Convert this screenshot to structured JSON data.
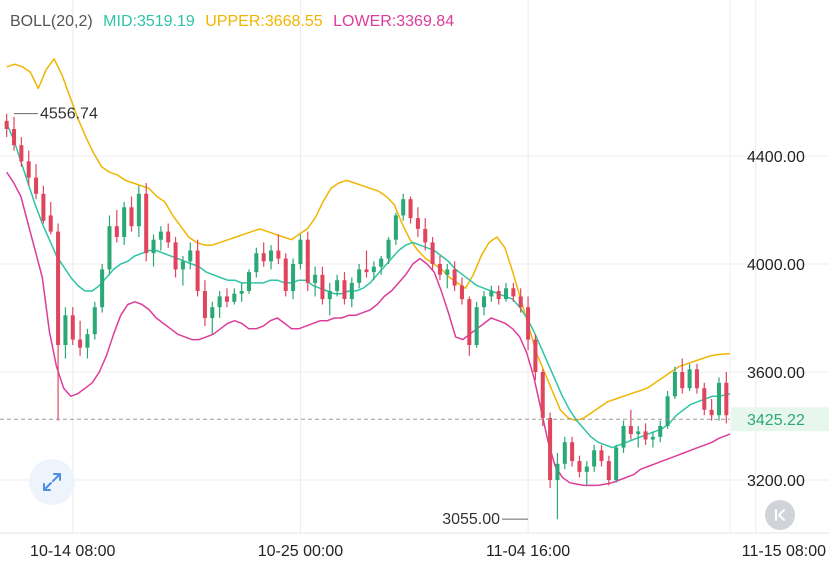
{
  "indicator": {
    "name": "BOLL(20,2)",
    "mid_label": "MID:",
    "mid_value": "3519.19",
    "upper_label": "UPPER:",
    "upper_value": "3668.55",
    "lower_label": "LOWER:",
    "lower_value": "3369.84"
  },
  "colors": {
    "up": "#2aa876",
    "down": "#e0455e",
    "mid": "#2ec4a6",
    "upper": "#f0b500",
    "lower": "#dc3d9b",
    "grid": "#ececec",
    "text": "#222222",
    "current_bg": "#e8f7ee",
    "current_text": "#2aa876"
  },
  "icons": {
    "expand": "expand-arrows-icon",
    "back": "double-chevron-left-icon"
  },
  "chart_data": {
    "type": "candlestick",
    "price_range": [
      3000,
      4700
    ],
    "y_ticks": [
      {
        "value": 4400,
        "label": "4400.00"
      },
      {
        "value": 4000,
        "label": "4000.00"
      },
      {
        "value": 3600,
        "label": "3600.00"
      },
      {
        "value": 3200,
        "label": "3200.00"
      }
    ],
    "x_labels": [
      {
        "index": 9,
        "label": "10-14 08:00"
      },
      {
        "index": 40,
        "label": "10-25 00:00"
      },
      {
        "index": 71,
        "label": "11-04 16:00"
      },
      {
        "index": 102,
        "label": "11-15 08:00"
      }
    ],
    "max_marker": {
      "index": 1,
      "value": 4556.74,
      "label": "4556.74"
    },
    "min_marker": {
      "index": 71,
      "value": 3055.0,
      "label": "3055.00"
    },
    "current_price": {
      "value": 3425.22,
      "label": "3425.22"
    },
    "candles": [
      [
        4530,
        4556,
        4470,
        4500
      ],
      [
        4500,
        4545,
        4420,
        4440
      ],
      [
        4440,
        4470,
        4360,
        4380
      ],
      [
        4380,
        4420,
        4290,
        4320
      ],
      [
        4320,
        4370,
        4240,
        4260
      ],
      [
        4260,
        4290,
        4150,
        4160
      ],
      [
        4180,
        4230,
        4110,
        4120
      ],
      [
        4120,
        4150,
        3420,
        3700
      ],
      [
        3700,
        3840,
        3650,
        3810
      ],
      [
        3810,
        3840,
        3700,
        3720
      ],
      [
        3720,
        3790,
        3660,
        3690
      ],
      [
        3690,
        3760,
        3650,
        3740
      ],
      [
        3740,
        3860,
        3720,
        3840
      ],
      [
        3840,
        4000,
        3820,
        3980
      ],
      [
        3980,
        4180,
        3960,
        4140
      ],
      [
        4140,
        4200,
        4080,
        4100
      ],
      [
        4100,
        4230,
        4070,
        4210
      ],
      [
        4210,
        4250,
        4120,
        4140
      ],
      [
        4140,
        4290,
        4100,
        4260
      ],
      [
        4260,
        4300,
        4010,
        4040
      ],
      [
        4040,
        4110,
        3990,
        4090
      ],
      [
        4090,
        4140,
        4050,
        4120
      ],
      [
        4120,
        4150,
        4060,
        4080
      ],
      [
        4080,
        4100,
        3950,
        3980
      ],
      [
        3980,
        4030,
        3920,
        4010
      ],
      [
        4010,
        4080,
        3980,
        4050
      ],
      [
        4050,
        4090,
        3880,
        3900
      ],
      [
        3900,
        3940,
        3770,
        3800
      ],
      [
        3800,
        3860,
        3740,
        3840
      ],
      [
        3840,
        3900,
        3800,
        3880
      ],
      [
        3880,
        3910,
        3840,
        3860
      ],
      [
        3860,
        3910,
        3850,
        3890
      ],
      [
        3890,
        3930,
        3860,
        3900
      ],
      [
        3900,
        3980,
        3890,
        3970
      ],
      [
        3970,
        4060,
        3950,
        4040
      ],
      [
        4040,
        4080,
        3990,
        4010
      ],
      [
        4010,
        4070,
        3980,
        4050
      ],
      [
        4050,
        4110,
        4000,
        4020
      ],
      [
        4020,
        4040,
        3880,
        3900
      ],
      [
        3900,
        4020,
        3870,
        4000
      ],
      [
        4000,
        4110,
        3980,
        4090
      ],
      [
        4090,
        4120,
        3900,
        3930
      ],
      [
        3930,
        3990,
        3880,
        3960
      ],
      [
        3960,
        3990,
        3850,
        3870
      ],
      [
        3870,
        3930,
        3810,
        3900
      ],
      [
        3900,
        3960,
        3880,
        3940
      ],
      [
        3940,
        3970,
        3850,
        3870
      ],
      [
        3870,
        3950,
        3840,
        3930
      ],
      [
        3930,
        4000,
        3910,
        3980
      ],
      [
        3980,
        4050,
        3950,
        3970
      ],
      [
        3970,
        4010,
        3940,
        3990
      ],
      [
        3990,
        4030,
        3960,
        4020
      ],
      [
        4020,
        4100,
        4000,
        4090
      ],
      [
        4090,
        4190,
        4070,
        4180
      ],
      [
        4180,
        4260,
        4160,
        4240
      ],
      [
        4240,
        4250,
        4150,
        4170
      ],
      [
        4170,
        4210,
        4100,
        4130
      ],
      [
        4130,
        4170,
        4050,
        4080
      ],
      [
        4080,
        4100,
        3980,
        4000
      ],
      [
        4000,
        4030,
        3940,
        3960
      ],
      [
        3960,
        4000,
        3910,
        3980
      ],
      [
        3980,
        4010,
        3900,
        3920
      ],
      [
        3920,
        3950,
        3850,
        3870
      ],
      [
        3870,
        3880,
        3660,
        3700
      ],
      [
        3700,
        3860,
        3690,
        3840
      ],
      [
        3840,
        3900,
        3810,
        3880
      ],
      [
        3880,
        3920,
        3860,
        3900
      ],
      [
        3900,
        3920,
        3850,
        3870
      ],
      [
        3870,
        3930,
        3860,
        3910
      ],
      [
        3910,
        3930,
        3860,
        3880
      ],
      [
        3880,
        3910,
        3820,
        3840
      ],
      [
        3840,
        3880,
        3680,
        3720
      ],
      [
        3720,
        3740,
        3570,
        3600
      ],
      [
        3600,
        3610,
        3400,
        3430
      ],
      [
        3430,
        3450,
        3170,
        3200
      ],
      [
        3200,
        3300,
        3055,
        3260
      ],
      [
        3260,
        3360,
        3240,
        3340
      ],
      [
        3340,
        3360,
        3250,
        3270
      ],
      [
        3270,
        3290,
        3210,
        3230
      ],
      [
        3230,
        3270,
        3180,
        3250
      ],
      [
        3250,
        3330,
        3230,
        3310
      ],
      [
        3310,
        3330,
        3250,
        3270
      ],
      [
        3270,
        3290,
        3180,
        3200
      ],
      [
        3200,
        3330,
        3190,
        3320
      ],
      [
        3320,
        3420,
        3300,
        3400
      ],
      [
        3400,
        3460,
        3350,
        3370
      ],
      [
        3370,
        3400,
        3320,
        3380
      ],
      [
        3380,
        3410,
        3330,
        3350
      ],
      [
        3350,
        3380,
        3320,
        3360
      ],
      [
        3360,
        3420,
        3340,
        3400
      ],
      [
        3400,
        3530,
        3390,
        3510
      ],
      [
        3510,
        3620,
        3500,
        3600
      ],
      [
        3600,
        3650,
        3520,
        3540
      ],
      [
        3540,
        3630,
        3530,
        3610
      ],
      [
        3610,
        3630,
        3520,
        3540
      ],
      [
        3540,
        3560,
        3440,
        3460
      ],
      [
        3460,
        3500,
        3420,
        3440
      ],
      [
        3440,
        3580,
        3420,
        3560
      ],
      [
        3560,
        3600,
        3410,
        3440
      ]
    ],
    "mid": [
      4520,
      4460,
      4380,
      4300,
      4220,
      4150,
      4090,
      4030,
      3990,
      3950,
      3920,
      3900,
      3900,
      3920,
      3950,
      3980,
      4000,
      4010,
      4030,
      4040,
      4050,
      4050,
      4040,
      4030,
      4020,
      4010,
      4000,
      3990,
      3970,
      3960,
      3950,
      3940,
      3940,
      3930,
      3930,
      3930,
      3930,
      3940,
      3940,
      3930,
      3930,
      3940,
      3940,
      3920,
      3910,
      3900,
      3890,
      3890,
      3900,
      3900,
      3910,
      3930,
      3960,
      3990,
      4020,
      4050,
      4070,
      4080,
      4070,
      4060,
      4050,
      4030,
      4010,
      3980,
      3960,
      3940,
      3920,
      3910,
      3900,
      3890,
      3880,
      3870,
      3840,
      3800,
      3750,
      3690,
      3630,
      3570,
      3510,
      3460,
      3420,
      3390,
      3360,
      3340,
      3330,
      3320,
      3330,
      3340,
      3350,
      3360,
      3370,
      3380,
      3390,
      3410,
      3440,
      3460,
      3480,
      3490,
      3500,
      3510,
      3510,
      3519
    ],
    "upper": [
      4730,
      4740,
      4730,
      4710,
      4650,
      4720,
      4760,
      4700,
      4620,
      4540,
      4470,
      4410,
      4360,
      4340,
      4330,
      4310,
      4300,
      4290,
      4280,
      4250,
      4230,
      4180,
      4140,
      4100,
      4080,
      4070,
      4070,
      4080,
      4090,
      4100,
      4110,
      4120,
      4130,
      4120,
      4110,
      4100,
      4090,
      4110,
      4130,
      4170,
      4230,
      4280,
      4300,
      4310,
      4300,
      4290,
      4280,
      4270,
      4250,
      4220,
      4150,
      4090,
      4050,
      4020,
      4000,
      3980,
      3950,
      3930,
      3910,
      3960,
      4030,
      4080,
      4100,
      4060,
      3970,
      3870,
      3770,
      3670,
      3600,
      3530,
      3460,
      3430,
      3420,
      3430,
      3450,
      3470,
      3490,
      3500,
      3510,
      3520,
      3530,
      3540,
      3560,
      3580,
      3600,
      3620,
      3630,
      3640,
      3650,
      3660,
      3665,
      3668
    ],
    "lower": [
      4340,
      4300,
      4250,
      4150,
      4050,
      3950,
      3750,
      3620,
      3540,
      3510,
      3520,
      3540,
      3560,
      3600,
      3660,
      3740,
      3810,
      3850,
      3860,
      3850,
      3830,
      3800,
      3780,
      3760,
      3740,
      3730,
      3720,
      3720,
      3730,
      3740,
      3760,
      3780,
      3790,
      3780,
      3760,
      3760,
      3770,
      3790,
      3800,
      3780,
      3760,
      3760,
      3770,
      3780,
      3790,
      3790,
      3800,
      3800,
      3810,
      3810,
      3820,
      3830,
      3850,
      3880,
      3900,
      3930,
      3960,
      4000,
      4020,
      4000,
      3970,
      3900,
      3820,
      3730,
      3720,
      3740,
      3760,
      3780,
      3800,
      3790,
      3780,
      3760,
      3730,
      3670,
      3580,
      3460,
      3340,
      3250,
      3210,
      3190,
      3185,
      3180,
      3180,
      3180,
      3185,
      3190,
      3200,
      3210,
      3220,
      3240,
      3250,
      3260,
      3270,
      3280,
      3290,
      3300,
      3310,
      3320,
      3330,
      3340,
      3355,
      3370
    ]
  }
}
